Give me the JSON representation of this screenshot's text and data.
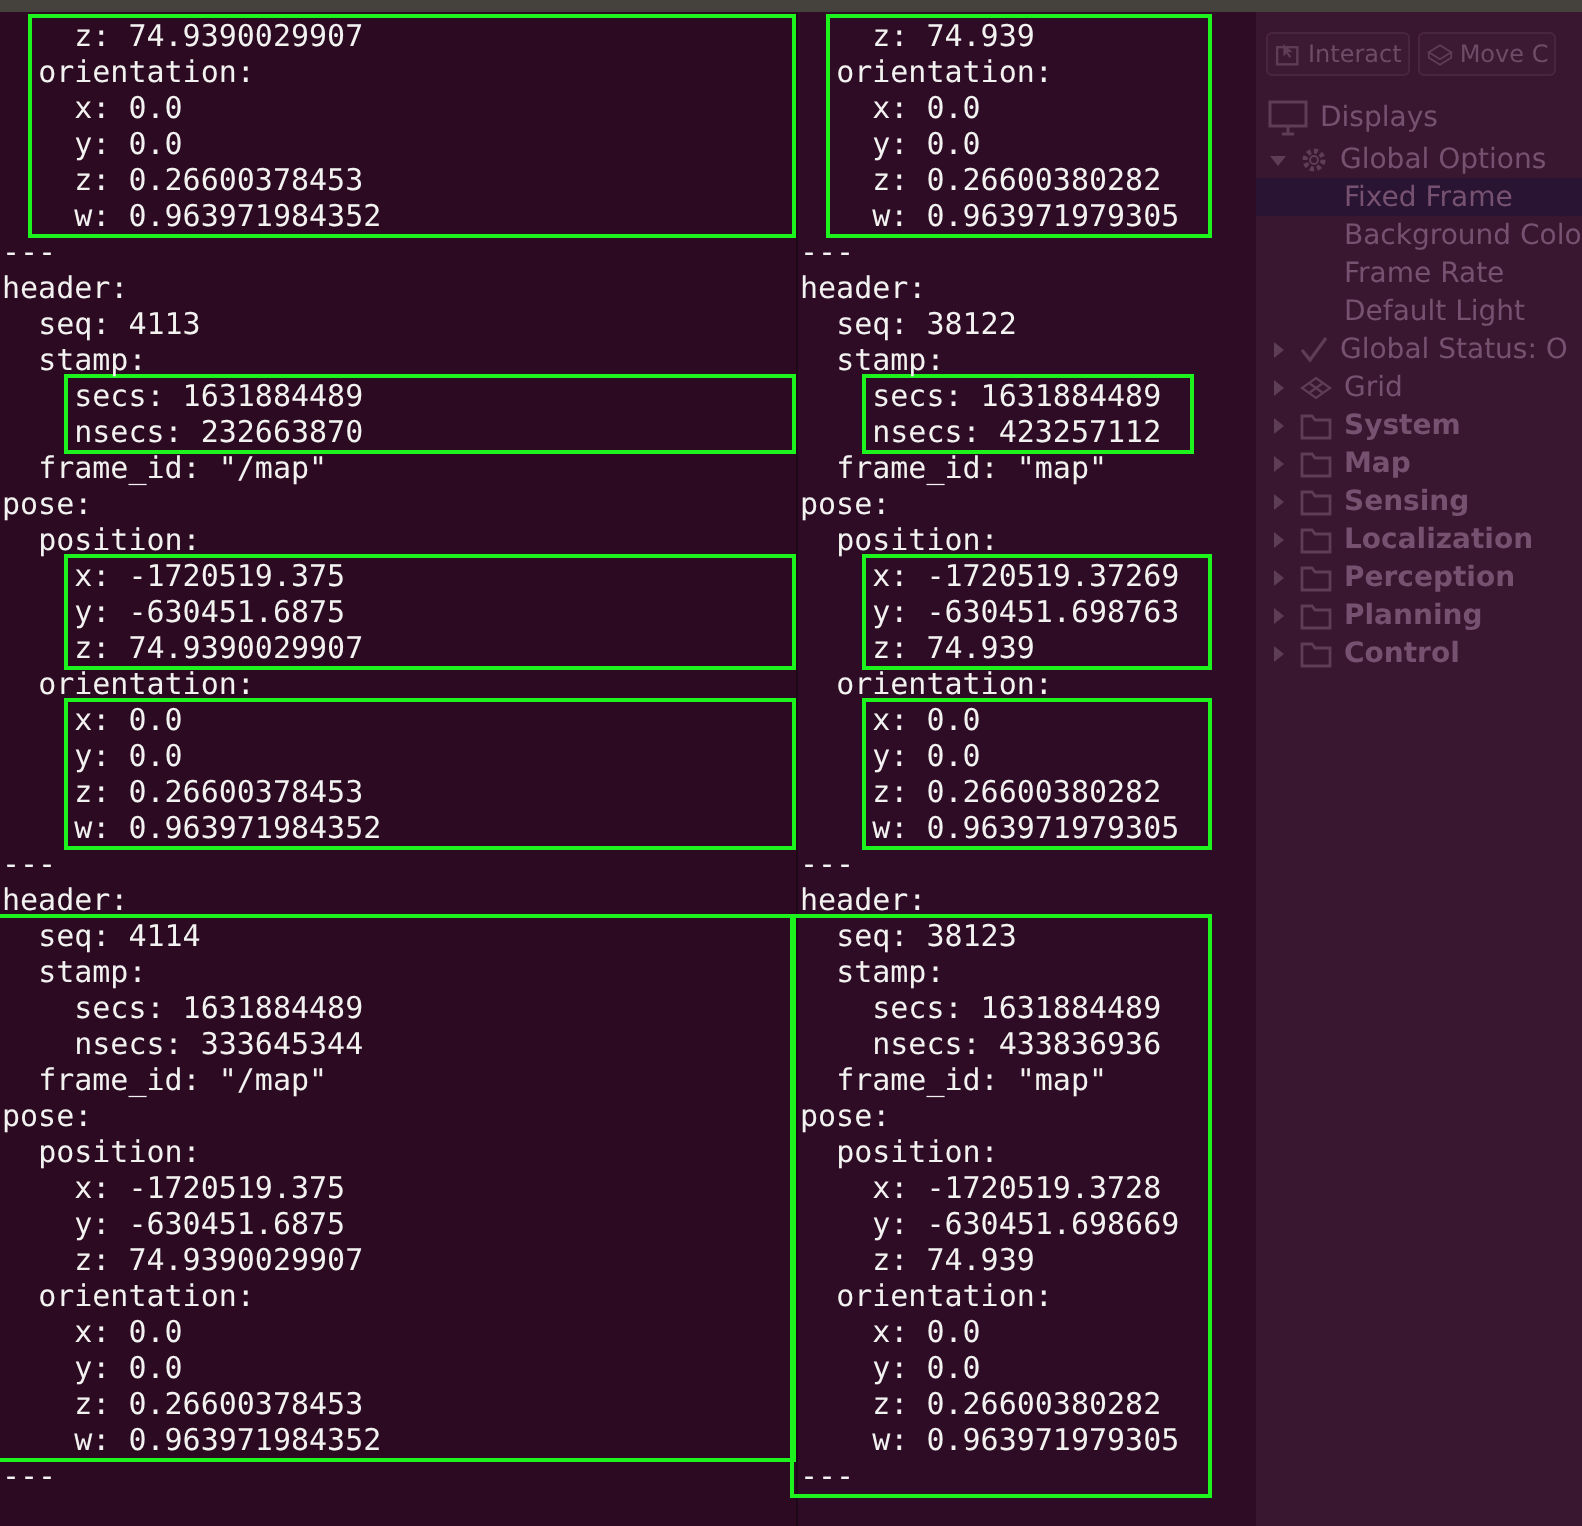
{
  "terminals": [
    {
      "segments": [
        {
          "boxed": true,
          "lines": [
            "    z: 74.9390029907",
            "  orientation:",
            "    x: 0.0",
            "    y: 0.0",
            "    z: 0.26600378453",
            "    w: 0.963971984352"
          ]
        },
        {
          "boxed": false,
          "lines": [
            "---",
            "header:",
            "  seq: 4113",
            "  stamp:"
          ]
        },
        {
          "boxed": true,
          "lines": [
            "    secs: 1631884489",
            "    nsecs: 232663870"
          ]
        },
        {
          "boxed": false,
          "lines": [
            "  frame_id: \"/map\"",
            "pose:",
            "  position:"
          ]
        },
        {
          "boxed": true,
          "lines": [
            "    x: -1720519.375",
            "    y: -630451.6875",
            "    z: 74.9390029907"
          ]
        },
        {
          "boxed": false,
          "lines": [
            "  orientation:"
          ]
        },
        {
          "boxed": true,
          "lines": [
            "    x: 0.0",
            "    y: 0.0",
            "    z: 0.26600378453",
            "    w: 0.963971984352"
          ]
        },
        {
          "boxed": false,
          "lines": [
            "---",
            "header:"
          ]
        },
        {
          "boxed": true,
          "lines": [
            "  seq: 4114",
            "  stamp:",
            "    secs: 1631884489",
            "    nsecs: 333645344",
            "  frame_id: \"/map\"",
            "pose:",
            "  position:",
            "    x: -1720519.375",
            "    y: -630451.6875",
            "    z: 74.9390029907",
            "  orientation:",
            "    x: 0.0",
            "    y: 0.0",
            "    z: 0.26600378453",
            "    w: 0.963971984352"
          ]
        },
        {
          "boxed": false,
          "lines": [
            "---"
          ]
        }
      ]
    },
    {
      "segments": [
        {
          "boxed": true,
          "lines": [
            "    z: 74.939",
            "  orientation:",
            "    x: 0.0",
            "    y: 0.0",
            "    z: 0.26600380282",
            "    w: 0.963971979305"
          ]
        },
        {
          "boxed": false,
          "lines": [
            "---",
            "header:",
            "  seq: 38122",
            "  stamp:"
          ]
        },
        {
          "boxed": true,
          "lines": [
            "    secs: 1631884489",
            "    nsecs: 423257112"
          ]
        },
        {
          "boxed": false,
          "lines": [
            "  frame_id: \"map\"",
            "pose:",
            "  position:"
          ]
        },
        {
          "boxed": true,
          "lines": [
            "    x: -1720519.37269",
            "    y: -630451.698763",
            "    z: 74.939"
          ]
        },
        {
          "boxed": false,
          "lines": [
            "  orientation:"
          ]
        },
        {
          "boxed": true,
          "lines": [
            "    x: 0.0",
            "    y: 0.0",
            "    z: 0.26600380282",
            "    w: 0.963971979305"
          ]
        },
        {
          "boxed": false,
          "lines": [
            "---",
            "header:"
          ]
        },
        {
          "boxed": true,
          "lines": [
            "  seq: 38123",
            "  stamp:",
            "    secs: 1631884489",
            "    nsecs: 433836936",
            "  frame_id: \"map\"",
            "pose:",
            "  position:",
            "    x: -1720519.3728",
            "    y: -630451.698669",
            "    z: 74.939",
            "  orientation:",
            "    x: 0.0",
            "    y: 0.0",
            "    z: 0.26600380282",
            "    w: 0.963971979305",
            "---"
          ]
        }
      ]
    }
  ],
  "rviz": {
    "tools": [
      {
        "label": "Interact",
        "kind": "interact"
      },
      {
        "label": "Move C",
        "kind": "move"
      }
    ],
    "displays_title": "Displays",
    "tree": [
      {
        "label": "Global Options",
        "kind": "options",
        "expanded": true,
        "selected": false,
        "children": [
          {
            "label": "Fixed Frame",
            "selected": true
          },
          {
            "label": "Background Colo",
            "selected": false
          },
          {
            "label": "Frame Rate",
            "selected": false
          },
          {
            "label": "Default Light",
            "selected": false
          }
        ]
      },
      {
        "label": "Global Status: O",
        "kind": "status",
        "expanded": false,
        "selected": false
      },
      {
        "label": "Grid",
        "kind": "grid",
        "expanded": false,
        "selected": false
      },
      {
        "label": "System",
        "kind": "folder",
        "expanded": false,
        "selected": false
      },
      {
        "label": "Map",
        "kind": "folder",
        "expanded": false,
        "selected": false
      },
      {
        "label": "Sensing",
        "kind": "folder",
        "expanded": false,
        "selected": false
      },
      {
        "label": "Localization",
        "kind": "folder",
        "expanded": false,
        "selected": false
      },
      {
        "label": "Perception",
        "kind": "folder",
        "expanded": false,
        "selected": false
      },
      {
        "label": "Planning",
        "kind": "folder",
        "expanded": false,
        "selected": false
      },
      {
        "label": "Control",
        "kind": "folder",
        "expanded": false,
        "selected": false
      }
    ]
  }
}
